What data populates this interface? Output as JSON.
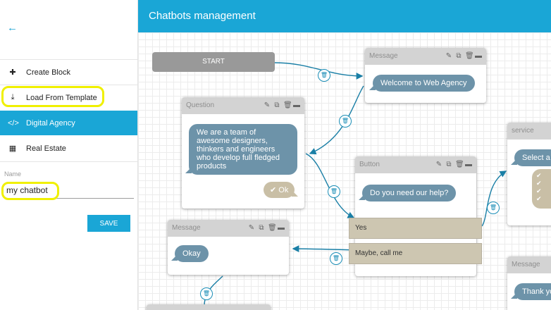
{
  "sidebar": {
    "back_icon": "arrow-left-icon",
    "items": [
      {
        "label": "Create Block",
        "icon": "plus-icon"
      },
      {
        "label": "Load From Template",
        "icon": "download-icon"
      },
      {
        "label": "Digital Agency",
        "icon": "code-icon"
      },
      {
        "label": "Real Estate",
        "icon": "building-icon"
      }
    ],
    "name_label": "Name",
    "name_value": "my chatbot",
    "save_label": "SAVE"
  },
  "header": {
    "title": "Chatbots management"
  },
  "canvas": {
    "start_label": "START",
    "blocks": {
      "message1": {
        "title": "Message",
        "text": "Welcome to Web Agency"
      },
      "question": {
        "title": "Question",
        "text": "We are a team of awesome designers, thinkers and engineers who develop full fledged products",
        "reply": "Ok"
      },
      "button": {
        "title": "Button",
        "text": "Do you need our help?",
        "options": [
          "Yes",
          "Maybe, call me"
        ]
      },
      "message2": {
        "title": "Message",
        "text": "Okay"
      },
      "service": {
        "title": "service",
        "text": "Select a"
      },
      "message3": {
        "title": "Message",
        "text": "Thank yo"
      }
    }
  },
  "colors": {
    "accent": "#1aa6d6",
    "bubble": "#6d93a9",
    "quick_reply": "#c9bfa6",
    "highlight": "#f0f000"
  }
}
